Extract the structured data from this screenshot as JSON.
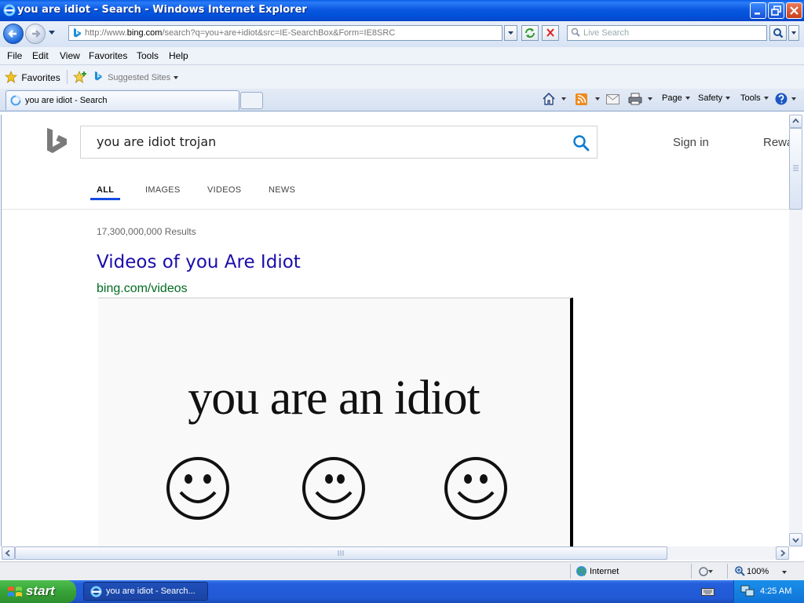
{
  "window": {
    "title": "you are idiot - Search - Windows Internet Explorer"
  },
  "addressbar": {
    "url_prefix": "http://www.",
    "url_domain": "bing.com",
    "url_suffix": "/search?q=you+are+idiot&src=IE-SearchBox&Form=IE8SRC",
    "search_placeholder": "Live Search"
  },
  "menu": [
    "File",
    "Edit",
    "View",
    "Favorites",
    "Tools",
    "Help"
  ],
  "favorites_bar": {
    "favorites_label": "Favorites",
    "suggested_sites": "Suggested Sites"
  },
  "tabs": [
    {
      "label": "you are idiot - Search"
    }
  ],
  "command_bar": {
    "page": "Page",
    "safety": "Safety",
    "tools": "Tools"
  },
  "bing": {
    "query": "you are idiot trojan",
    "sign_in": "Sign in",
    "rewards": "Rewa",
    "scopes": [
      "ALL",
      "IMAGES",
      "VIDEOS",
      "NEWS"
    ],
    "active_scope": "ALL",
    "results_count": "17,300,000,000 Results",
    "result": {
      "title": "Videos of you Are Idiot",
      "url": "bing.com/videos",
      "thumbnail_text": "you are an idiot"
    }
  },
  "statusbar": {
    "zone": "Internet",
    "zoom": "100%"
  },
  "taskbar": {
    "start": "start",
    "item": "you are idiot - Search...",
    "clock": "4:25 AM"
  },
  "colors": {
    "link": "#1a0dab",
    "url_green": "#006d21",
    "bing_blue": "#174ae4",
    "xp_blue": "#0a58e0"
  }
}
